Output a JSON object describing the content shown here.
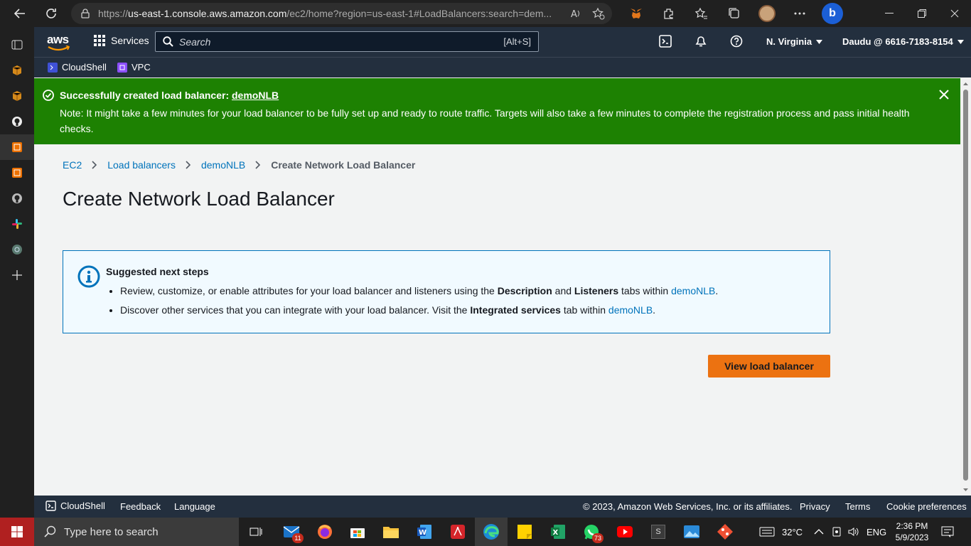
{
  "browser": {
    "url_prefix": "https://",
    "url_host": "us-east-1.console.aws.amazon.com",
    "url_path": "/ec2/home?region=us-east-1#LoadBalancers:search=dem..."
  },
  "aws": {
    "logo_text": "aws",
    "services_label": "Services",
    "search_placeholder": "Search",
    "search_shortcut": "[Alt+S]",
    "region": "N. Virginia",
    "account": "Daudu @ 6616-7183-8154",
    "favorites": [
      "CloudShell",
      "VPC"
    ]
  },
  "banner": {
    "title_prefix": "Successfully created load balancer: ",
    "title_link": "demoNLB",
    "message": "Note: It might take a few minutes for your load balancer to be fully set up and ready to route traffic. Targets will also take a few minutes to complete the registration process and pass initial health checks."
  },
  "breadcrumb": {
    "items": [
      "EC2",
      "Load balancers",
      "demoNLB"
    ],
    "current": "Create Network Load Balancer"
  },
  "page_title": "Create Network Load Balancer",
  "info": {
    "title": "Suggested next steps",
    "step1": {
      "a": "Review, customize, or enable attributes for your load balancer and listeners using the ",
      "b": "Description",
      "c": " and ",
      "d": "Listeners",
      "e": " tabs within ",
      "link": "demoNLB",
      "end": "."
    },
    "step2": {
      "a": "Discover other services that you can integrate with your load balancer. Visit the ",
      "b": "Integrated services",
      "c": " tab within ",
      "link": "demoNLB",
      "end": "."
    }
  },
  "primary_button": "View load balancer",
  "footer": {
    "cloudshell": "CloudShell",
    "feedback": "Feedback",
    "language": "Language",
    "copyright": "© 2023, Amazon Web Services, Inc. or its affiliates.",
    "privacy": "Privacy",
    "terms": "Terms",
    "cookies": "Cookie preferences"
  },
  "taskbar": {
    "search_placeholder": "Type here to search",
    "mail_badge": "11",
    "whatsapp_badge": "73",
    "weather": "32°C",
    "lang": "ENG",
    "time": "2:36 PM",
    "date": "5/9/2023"
  },
  "colors": {
    "aws_nav": "#232f3e",
    "success": "#1d8102",
    "link": "#0073bb",
    "primary": "#ec7211"
  }
}
